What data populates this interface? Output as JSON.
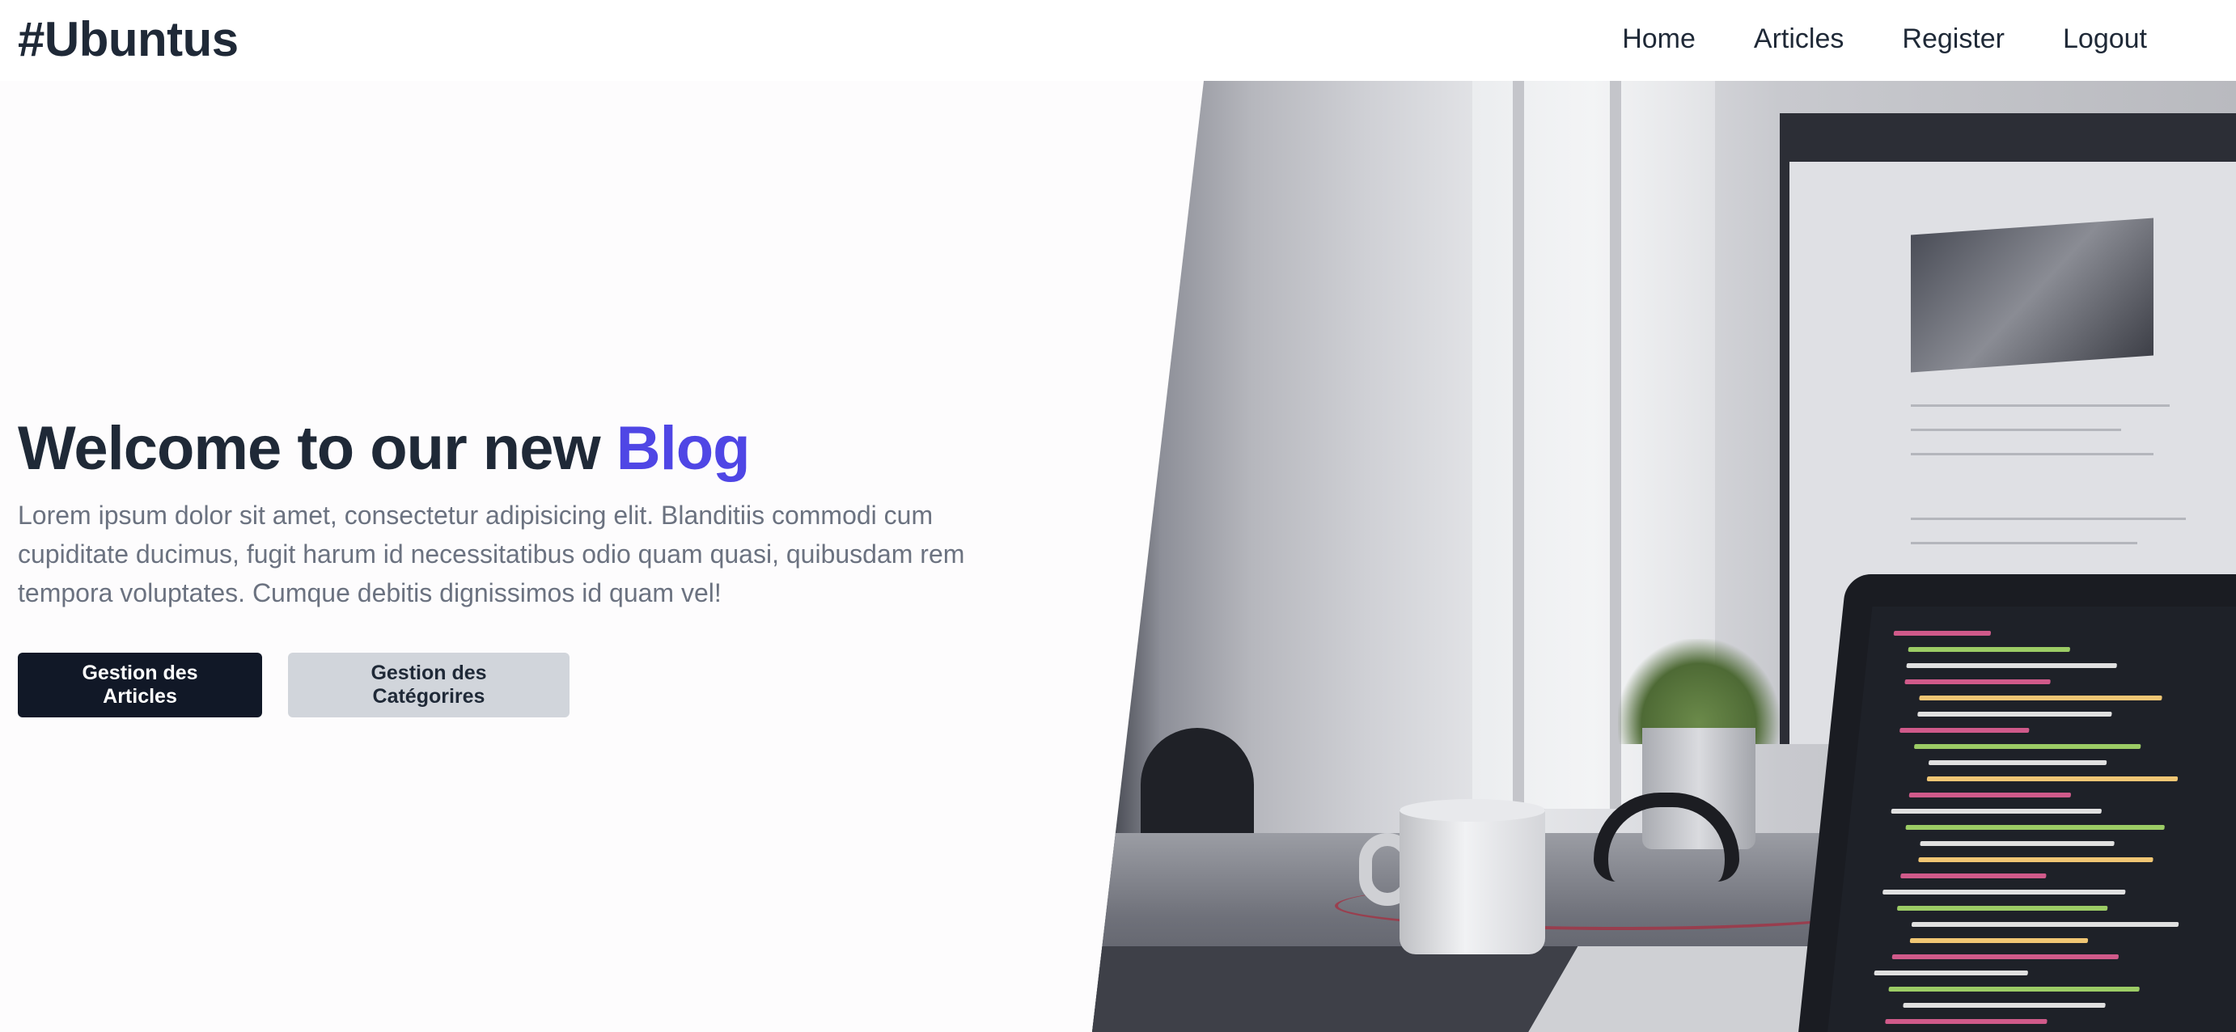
{
  "navbar": {
    "brand": "#Ubuntus",
    "links": [
      {
        "label": "Home"
      },
      {
        "label": "Articles"
      },
      {
        "label": "Register"
      },
      {
        "label": "Logout"
      }
    ]
  },
  "hero": {
    "title_prefix": "Welcome to our new ",
    "title_accent": "Blog",
    "description": "Lorem ipsum dolor sit amet, consectetur adipisicing elit. Blanditiis commodi cum cupiditate ducimus, fugit harum id necessitatibus odio quam quasi, quibusdam rem tempora voluptates. Cumque debitis dignissimos id quam vel!",
    "buttons": {
      "primary_label": "Gestion des Articles",
      "secondary_label": "Gestion des Catégorires"
    }
  },
  "colors": {
    "accent": "#4f46e5",
    "primary_button": "#111827",
    "secondary_button": "#d1d5db",
    "text_dark": "#1f2937",
    "text_muted": "#6b7280"
  },
  "image": {
    "subject": "workspace-photo-laptop-code-monitor-mug"
  }
}
